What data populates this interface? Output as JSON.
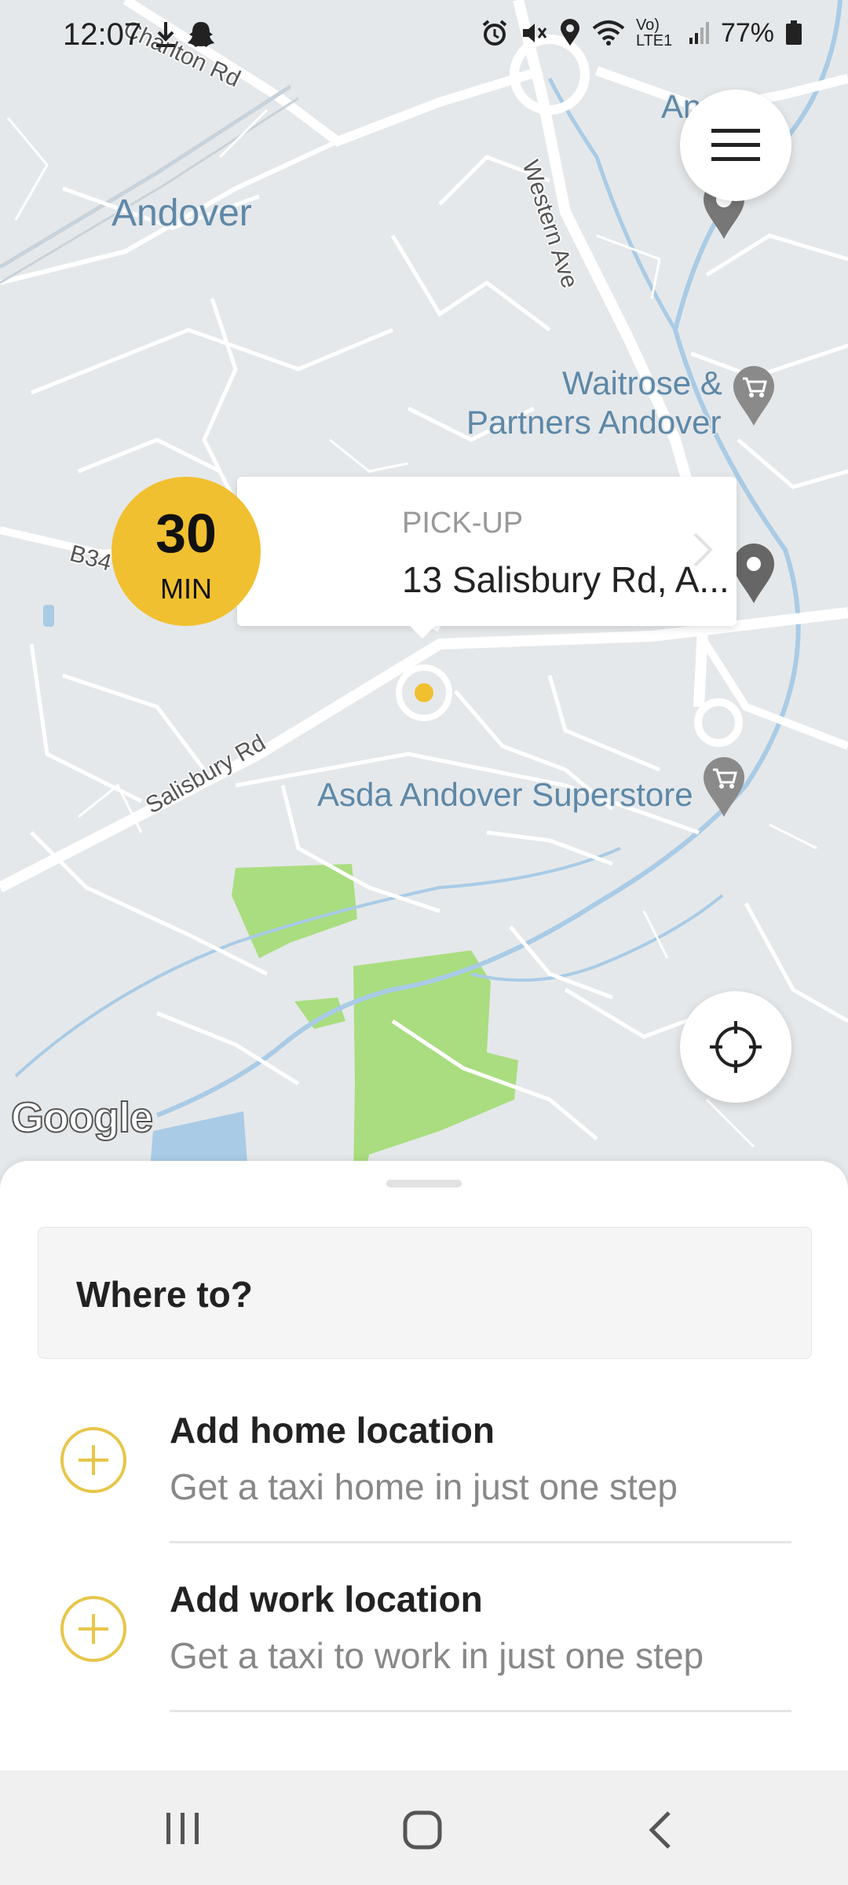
{
  "status_bar": {
    "time": "12:07",
    "battery": "77%",
    "network": "Vo) LTE1"
  },
  "map": {
    "labels": {
      "town": "Andover",
      "poi_waitrose_line1": "Waitrose &",
      "poi_waitrose_line2": "Partners Andover",
      "poi_asda": "Asda Andover Superstore",
      "poi_top_right": "An…",
      "road_charlton": "Charlton Rd",
      "road_western": "Western Ave",
      "road_salisbury": "Salisbury Rd",
      "road_b34": "B34"
    },
    "attribution": "Google",
    "colors": {
      "land": "#e5e8ea",
      "road": "#ffffff",
      "water": "#a9cbe6",
      "park": "#a9dd7f",
      "accent": "#f0c030"
    }
  },
  "pickup": {
    "eta_value": "30",
    "eta_unit": "MIN",
    "label": "PICK-UP",
    "address": "13 Salisbury Rd, A..."
  },
  "sheet": {
    "search_placeholder": "Where to?",
    "shortcuts": [
      {
        "title": "Add home location",
        "subtitle": "Get a taxi home in just one step"
      },
      {
        "title": "Add work location",
        "subtitle": "Get a taxi to work in just one step"
      }
    ]
  }
}
